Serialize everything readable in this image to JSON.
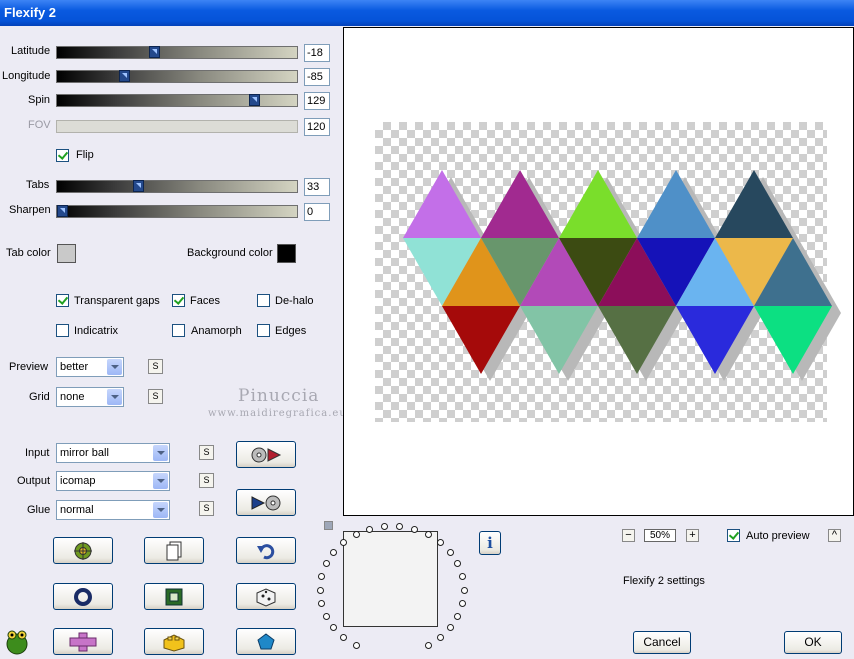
{
  "window": {
    "title": "Flexify 2"
  },
  "sliders": {
    "latitude": {
      "label": "Latitude",
      "value": "-18",
      "fraction": 0.4
    },
    "longitude": {
      "label": "Longitude",
      "value": "-85",
      "fraction": 0.27
    },
    "spin": {
      "label": "Spin",
      "value": "129",
      "fraction": 0.84
    },
    "fov": {
      "label": "FOV",
      "value": "120",
      "fraction": 0.0
    },
    "tabs": {
      "label": "Tabs",
      "value": "33",
      "fraction": 0.33
    },
    "sharpen": {
      "label": "Sharpen",
      "value": "0",
      "fraction": 0.0
    }
  },
  "flip": {
    "label": "Flip",
    "checked": true
  },
  "colors": {
    "tab_label": "Tab color",
    "tab_color": "#c9c9c9",
    "bg_label": "Background color",
    "bg_color": "#000000"
  },
  "options": {
    "transparent_gaps": {
      "label": "Transparent gaps",
      "checked": true
    },
    "faces": {
      "label": "Faces",
      "checked": true
    },
    "de_halo": {
      "label": "De-halo",
      "checked": false
    },
    "indicatrix": {
      "label": "Indicatrix",
      "checked": false
    },
    "anamorph": {
      "label": "Anamorph",
      "checked": false
    },
    "edges": {
      "label": "Edges",
      "checked": false
    }
  },
  "selects": {
    "preview": {
      "label": "Preview",
      "value": "better"
    },
    "grid": {
      "label": "Grid",
      "value": "none"
    },
    "input": {
      "label": "Input",
      "value": "mirror ball"
    },
    "output": {
      "label": "Output",
      "value": "icomap"
    },
    "glue": {
      "label": "Glue",
      "value": "normal"
    }
  },
  "s_button_label": "S",
  "watermark": {
    "name": "Pinuccia",
    "url": "www.maidiregrafica.eu"
  },
  "zoom": {
    "value": "50%",
    "minus": "−",
    "plus": "+"
  },
  "auto_preview": {
    "label": "Auto preview",
    "checked": true
  },
  "caret_label": "^",
  "info_label": "i",
  "settings_label": "Flexify 2 settings",
  "buttons": {
    "cancel": "Cancel",
    "ok": "OK"
  },
  "icons": [
    "film-forward-icon",
    "film-back-icon",
    "gear-icon",
    "new-page-icon",
    "undo-icon",
    "ring-icon",
    "square-icon",
    "dice-icon",
    "cross-icon",
    "brick-icon",
    "pentagon-icon",
    "frog-icon",
    "info-icon"
  ],
  "palette": [
    "#c36fe8",
    "#a12a90",
    "#7ade2b",
    "#4f90c8",
    "#27485e",
    "#90e2d6",
    "#e0941b",
    "#68966c",
    "#b24ab8",
    "#3c4b12",
    "#8c0e5a",
    "#1512b8",
    "#6ab4f0",
    "#ecb84a",
    "#3e708e",
    "#a50a0a",
    "#82c4a6",
    "#567044",
    "#2a2adc",
    "#0ce082"
  ]
}
